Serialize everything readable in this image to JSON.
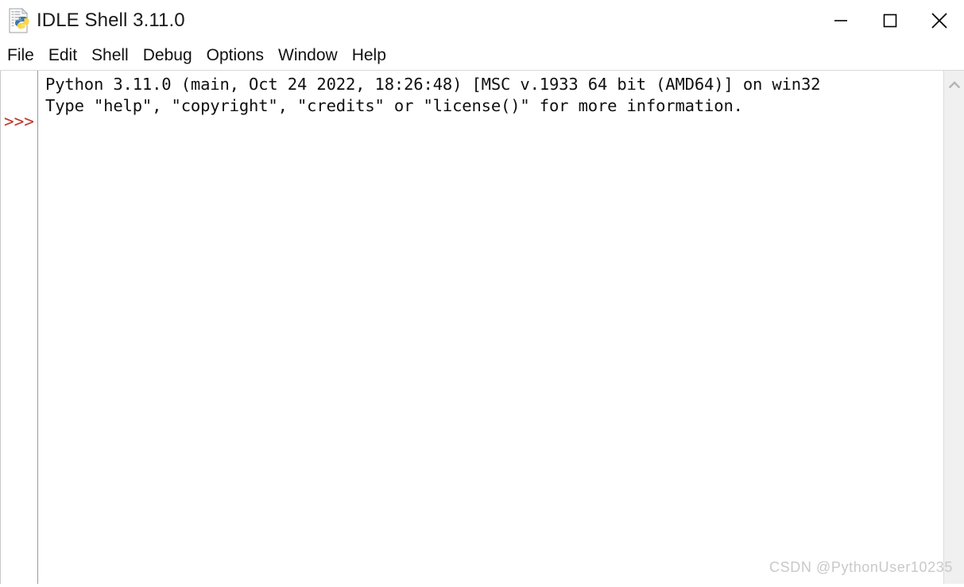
{
  "window": {
    "title": "IDLE Shell 3.11.0",
    "app_icon": "python-document-icon",
    "controls": {
      "minimize": "minimize-icon",
      "maximize": "maximize-icon",
      "close": "close-icon"
    }
  },
  "menu": {
    "items": [
      {
        "label": "File"
      },
      {
        "label": "Edit"
      },
      {
        "label": "Shell"
      },
      {
        "label": "Debug"
      },
      {
        "label": "Options"
      },
      {
        "label": "Window"
      },
      {
        "label": "Help"
      }
    ]
  },
  "shell": {
    "prompt": ">>>",
    "prompt_color": "#C0392B",
    "lines": [
      "Python 3.11.0 (main, Oct 24 2022, 18:26:48) [MSC v.1933 64 bit (AMD64)] on win32",
      "Type \"help\", \"copyright\", \"credits\" or \"license()\" for more information."
    ]
  },
  "scrollbar": {
    "up_arrow": "chevron-up-icon"
  },
  "watermark": {
    "text": "CSDN @PythonUser10235"
  },
  "colors": {
    "background": "#ffffff",
    "text": "#101010",
    "prompt": "#C0392B",
    "scrollbar_track": "#f0f0f0",
    "border": "#9a9a9a"
  }
}
